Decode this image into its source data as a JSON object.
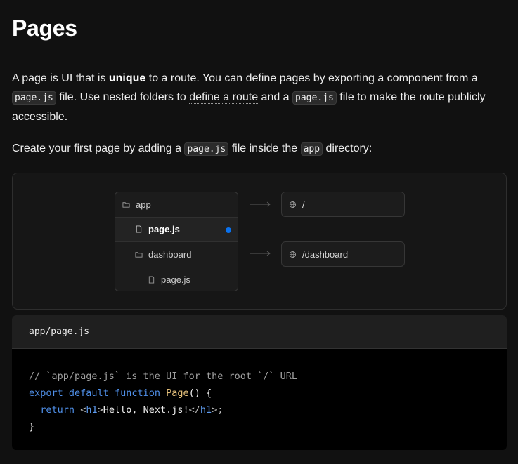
{
  "page": {
    "title": "Pages"
  },
  "paragraph1": {
    "t1": "A page is UI that is ",
    "bold": "unique",
    "t2": " to a route. You can define pages by exporting a component from a ",
    "code1": "page.js",
    "t3": " file. Use nested folders to ",
    "link": "define a route",
    "t4": " and a ",
    "code2": "page.js",
    "t5": " file to make the route publicly accessible."
  },
  "paragraph2": {
    "t1": "Create your first page by adding a ",
    "code1": "page.js",
    "t2": " file inside the ",
    "code2": "app",
    "t3": " directory:"
  },
  "diagram": {
    "tree": [
      {
        "label": "app",
        "icon": "folder-icon"
      },
      {
        "label": "page.js",
        "icon": "file-icon",
        "active": true
      },
      {
        "label": "dashboard",
        "icon": "folder-icon"
      },
      {
        "label": "page.js",
        "icon": "file-icon"
      }
    ],
    "routes": [
      {
        "label": "/",
        "icon": "globe-icon"
      },
      {
        "label": "/dashboard",
        "icon": "globe-icon"
      }
    ],
    "accent_color": "#0a72ef"
  },
  "codeblock": {
    "filename": "app/page.js",
    "comment": "// `app/page.js` is the UI for the root `/` URL",
    "kw_export": "export",
    "kw_default": "default",
    "kw_function": "function",
    "fn_name": "Page",
    "fn_tail": "() {",
    "kw_return": "return",
    "tag_open_lt": "<",
    "tag_name": "h1",
    "tag_open_gt": ">",
    "text": "Hello, Next.js!",
    "tag_close_lt": "</",
    "tag_close_name": "h1",
    "tag_close_gt": ">;",
    "close_brace": "}"
  }
}
